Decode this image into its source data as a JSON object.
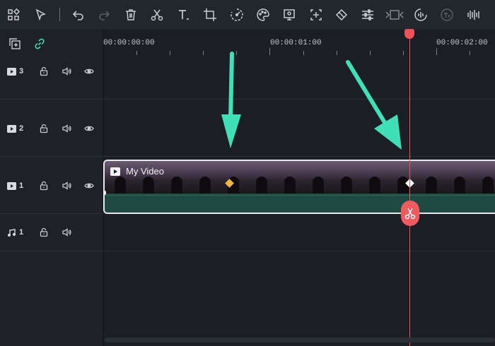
{
  "toolbar": {
    "items": [
      {
        "name": "layout-icon"
      },
      {
        "name": "select-pointer-icon"
      },
      {
        "name": "undo-icon"
      },
      {
        "name": "redo-icon"
      },
      {
        "name": "delete-icon"
      },
      {
        "name": "scissors-icon"
      },
      {
        "name": "text-icon"
      },
      {
        "name": "crop-icon"
      },
      {
        "name": "speed-icon"
      },
      {
        "name": "color-palette-icon"
      },
      {
        "name": "green-screen-icon"
      },
      {
        "name": "add-frame-icon"
      },
      {
        "name": "keyframe-icon"
      },
      {
        "name": "adjust-sliders-icon"
      },
      {
        "name": "video-freeze-icon"
      },
      {
        "name": "audio-wave-icon"
      },
      {
        "name": "speech-to-text-icon"
      },
      {
        "name": "audio-levels-icon"
      }
    ]
  },
  "timeline": {
    "ruler": [
      "00:00:00:00",
      "00:00:01:00",
      "00:00:02:00"
    ],
    "tracks": [
      {
        "type": "video",
        "number": "3"
      },
      {
        "type": "video",
        "number": "2"
      },
      {
        "type": "video",
        "number": "1"
      },
      {
        "type": "audio",
        "number": "1"
      }
    ],
    "clip": {
      "title": "My Video"
    }
  },
  "colors": {
    "accent_green": "#3fe0b8",
    "playhead": "#ef4f57",
    "keyframe_selected": "#f5b63a",
    "clip_fill": "#1e4a42"
  }
}
